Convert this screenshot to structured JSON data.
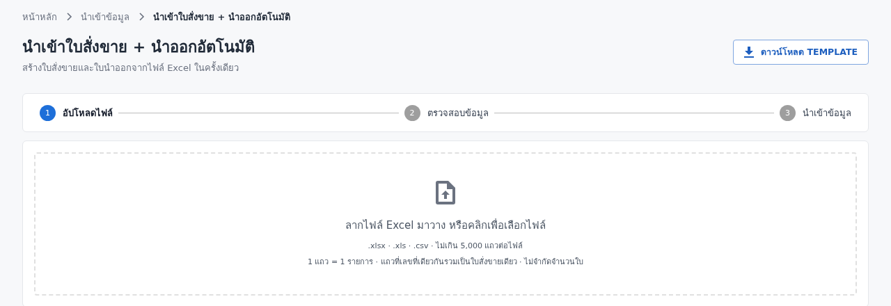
{
  "breadcrumbs": [
    {
      "label": "หน้าหลัก",
      "current": false
    },
    {
      "label": "นำเข้าข้อมูล",
      "current": false
    },
    {
      "label": "นำเข้าใบสั่งขาย + นำออกอัตโนมัติ",
      "current": true
    }
  ],
  "header": {
    "title": "นำเข้าใบสั่งขาย + นำออกอัตโนมัติ",
    "subtitle": "สร้างใบสั่งขายและใบนำออกจากไฟล์ Excel ในครั้งเดียว",
    "download_button": "ดาวน์โหลด TEMPLATE"
  },
  "steps": [
    {
      "number": "1",
      "label": "อัปโหลดไฟล์",
      "selected": true
    },
    {
      "number": "2",
      "label": "ตรวจสอบข้อมูล",
      "selected": false
    },
    {
      "number": "3",
      "label": "นำเข้าข้อมูล",
      "selected": false
    }
  ],
  "dropzone": {
    "title": "ลากไฟล์ Excel มาวาง หรือคลิกเพื่อเลือกไฟล์",
    "hint": ".xlsx · .xls · .csv · ไม่เกิน 5,000 แถวต่อไฟล์",
    "note": "1 แถว = 1 รายการ · แถวที่เลขที่เดียวกันรวมเป็นใบสั่งขายเดียว · ไม่จำกัดจำนวนใบ"
  }
}
